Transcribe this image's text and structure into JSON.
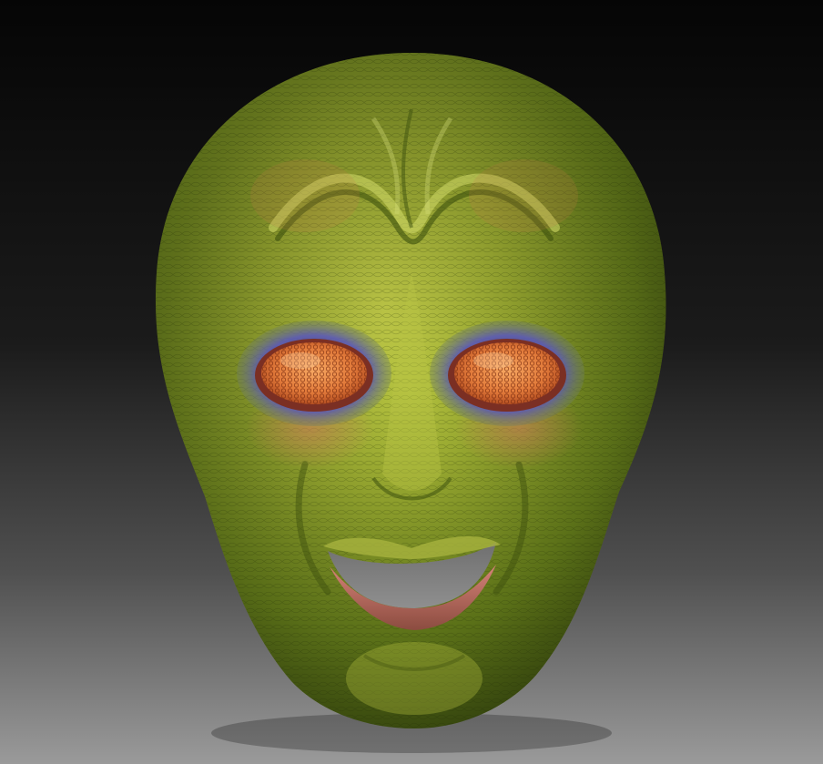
{
  "scene": {
    "subject": "alien-head-sculpt",
    "colors": {
      "background_top": "#050505",
      "background_mid": "#2a2a2a",
      "background_bottom": "#9a9a9a",
      "skin_light": "#b7c43c",
      "skin_mid": "#7f9a22",
      "skin_dark": "#3f5410",
      "skin_warm": "#c98a4a",
      "eye_socket": "#5a58b8",
      "eye_rim": "#7b2f23",
      "eye_lens": "#e27a3a",
      "eye_highlight": "#f3a15b",
      "mouth_interior": "#8a8a8a",
      "lip": "#c06c60"
    }
  }
}
